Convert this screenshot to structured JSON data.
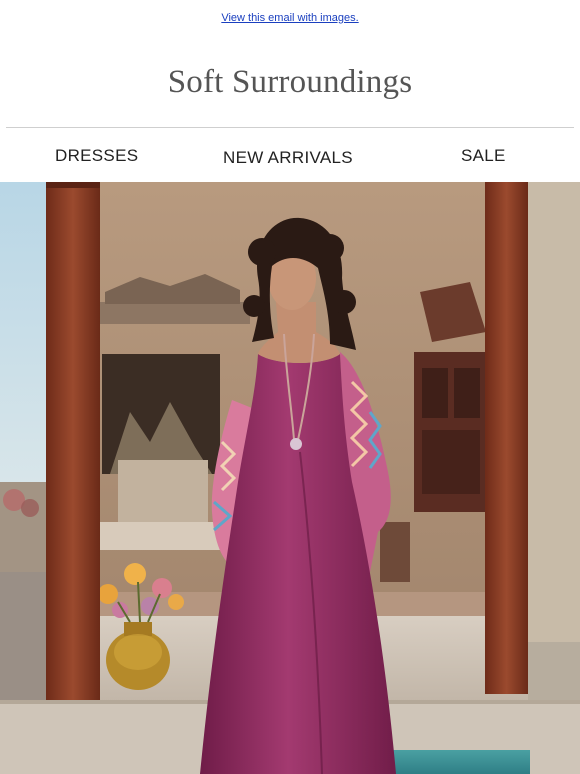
{
  "preheader": {
    "link_text": "View this email with images."
  },
  "brand": {
    "name": "Soft Surroundings"
  },
  "nav": {
    "items": [
      {
        "label": "DRESSES"
      },
      {
        "label": "NEW ARRIVALS"
      },
      {
        "label": "SALE"
      }
    ]
  },
  "hero": {
    "icon": "hero-photo-woman-in-magenta-maxi-dress"
  },
  "colors": {
    "link": "#1a3fbf",
    "dress": "#8e2a5e",
    "pillar": "#8a3c26",
    "wall": "#b79a80",
    "sky": "#a9cde0"
  }
}
